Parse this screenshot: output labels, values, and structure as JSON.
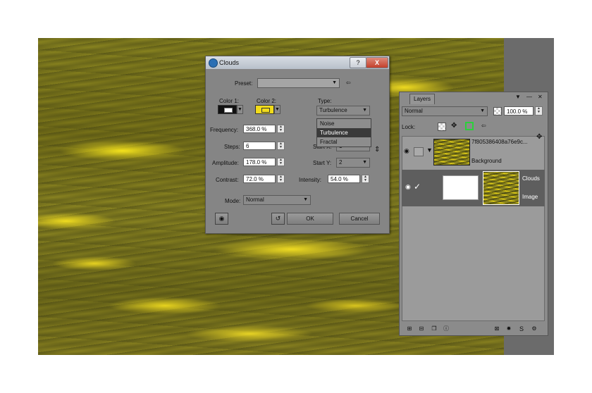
{
  "dialog": {
    "title": "Clouds",
    "help_label": "?",
    "close_label": "X",
    "preset_label": "Preset:",
    "preset_value": "",
    "color1_label": "Color 1:",
    "color2_label": "Color 2:",
    "type_label": "Type:",
    "type_value": "Turbulence",
    "type_options": [
      "Noise",
      "Turbulence",
      "Fractal"
    ],
    "frequency_label": "Frequency:",
    "frequency_value": "368.0 %",
    "steps_label": "Steps:",
    "steps_value": "6",
    "amplitude_label": "Amplitude:",
    "amplitude_value": "178.0 %",
    "contrast_label": "Contrast:",
    "contrast_value": "72.0 %",
    "startx_label": "Start X:",
    "startx_value": "1",
    "starty_label": "Start Y:",
    "starty_value": "2",
    "intensity_label": "Intensity:",
    "intensity_value": "54.0 %",
    "mode_label": "Mode:",
    "mode_value": "Normal",
    "ok_label": "OK",
    "cancel_label": "Cancel",
    "color1": "#111111",
    "color2": "#f2dc1a"
  },
  "layers": {
    "tab_label": "Layers",
    "blend_mode": "Normal",
    "opacity": "100.0 %",
    "lock_label": "Lock:",
    "items": [
      {
        "name": "7f805386408a76e9c...",
        "sub": "Background"
      },
      {
        "name": "Clouds",
        "sub": "Image"
      }
    ]
  },
  "colors": {
    "canvas_yellow": "#e8d41e",
    "panel_gray": "#8b8b8b",
    "selected_row": "#5e5e5e"
  }
}
